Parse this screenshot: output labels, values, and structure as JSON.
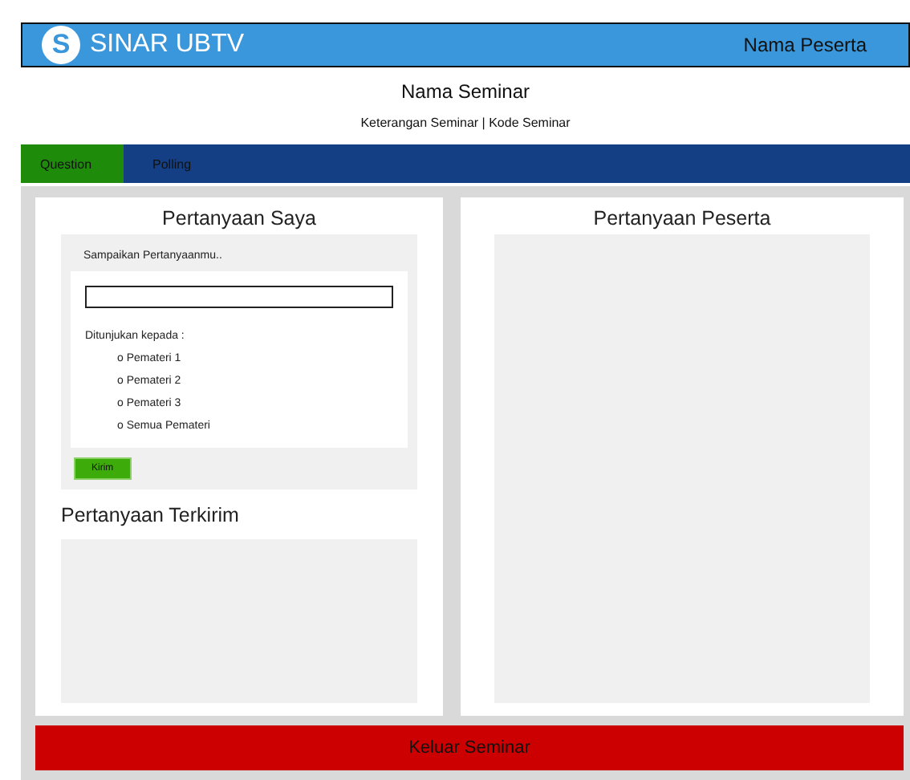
{
  "header": {
    "brand": "SINAR UBTV",
    "logo_letter": "S",
    "user": "Nama Peserta"
  },
  "seminar": {
    "title": "Nama Seminar",
    "subtitle": "Keterangan Seminar | Kode Seminar"
  },
  "tabs": [
    {
      "label": "Question",
      "selected": true
    },
    {
      "label": "Polling",
      "selected": false
    }
  ],
  "my_questions": {
    "title": "Pertanyaan Saya",
    "prompt": "Sampaikan Pertanyaanmu..",
    "addressed_to": "Ditunjukan kepada :",
    "options": [
      "o Pemateri 1",
      "o Pemateri 2",
      "o Pemateri 3",
      "o Semua Pemateri"
    ],
    "submit": "Kirim",
    "sent_title": "Pertanyaan Terkirim"
  },
  "participant_questions": {
    "title": "Pertanyaan Peserta"
  },
  "exit_button": "Keluar Seminar"
}
